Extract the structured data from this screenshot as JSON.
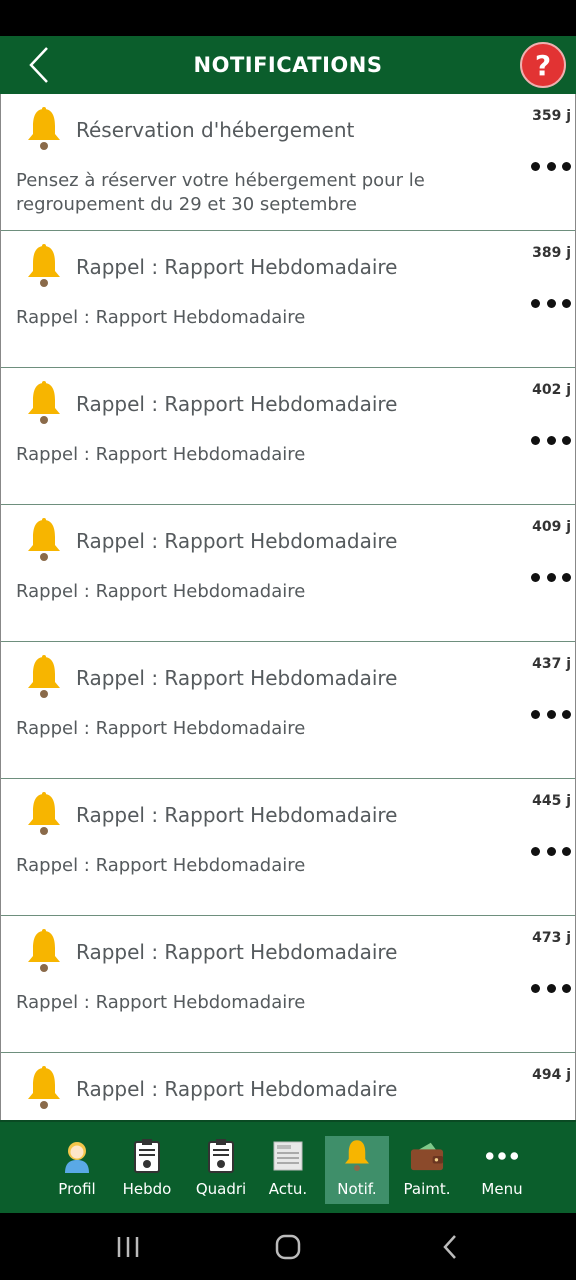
{
  "header": {
    "title": "NOTIFICATIONS",
    "help_label": "?"
  },
  "notifications": [
    {
      "title": "Réservation d'hébergement",
      "body": "Pensez à réserver votre hébergement pour le regroupement du 29 et 30 septembre",
      "age": "359 j"
    },
    {
      "title": "Rappel : Rapport Hebdomadaire",
      "body": "Rappel : Rapport Hebdomadaire",
      "age": "389 j"
    },
    {
      "title": "Rappel : Rapport Hebdomadaire",
      "body": "Rappel : Rapport Hebdomadaire",
      "age": "402 j"
    },
    {
      "title": "Rappel : Rapport Hebdomadaire",
      "body": "Rappel : Rapport Hebdomadaire",
      "age": "409 j"
    },
    {
      "title": "Rappel : Rapport Hebdomadaire",
      "body": "Rappel : Rapport Hebdomadaire",
      "age": "437 j"
    },
    {
      "title": "Rappel : Rapport Hebdomadaire",
      "body": "Rappel : Rapport Hebdomadaire",
      "age": "445 j"
    },
    {
      "title": "Rappel : Rapport Hebdomadaire",
      "body": "Rappel : Rapport Hebdomadaire",
      "age": "473 j"
    },
    {
      "title": "Rappel : Rapport Hebdomadaire",
      "body": "",
      "age": "494 j"
    }
  ],
  "tabs": [
    {
      "label": "Profil",
      "icon": "profile-icon"
    },
    {
      "label": "Hebdo",
      "icon": "clipboard-icon"
    },
    {
      "label": "Quadri",
      "icon": "clipboard-icon"
    },
    {
      "label": "Actu.",
      "icon": "newspaper-icon"
    },
    {
      "label": "Notif.",
      "icon": "bell-icon",
      "active": true
    },
    {
      "label": "Paimt.",
      "icon": "wallet-icon"
    },
    {
      "label": "Menu",
      "icon": "more-icon"
    }
  ],
  "colors": {
    "brand_green": "#0b5e2c",
    "active_tab": "#3f8f6a",
    "help_red": "#e23333",
    "bell_yellow": "#f7b500"
  }
}
